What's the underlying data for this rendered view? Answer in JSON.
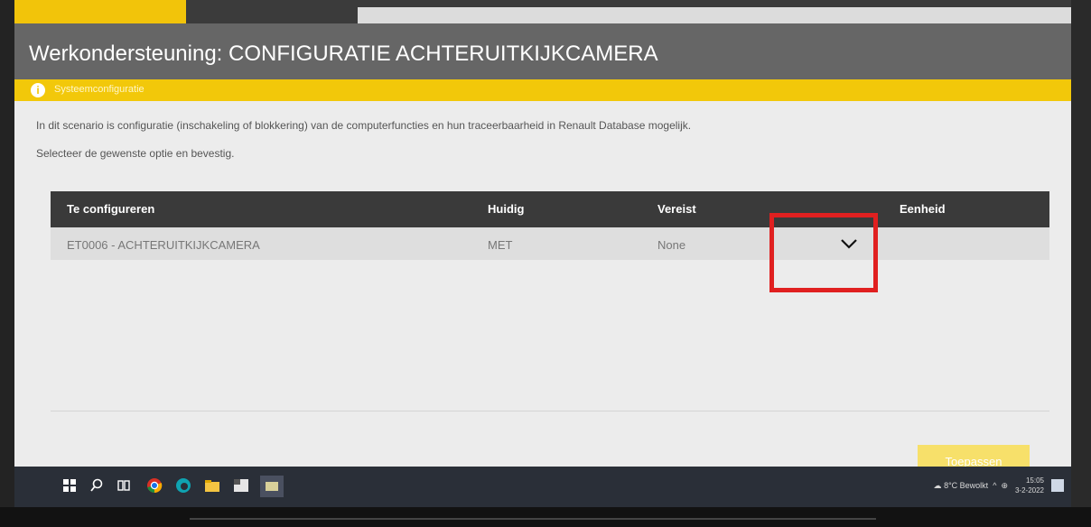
{
  "window": {
    "title": "Werkondersteuning: CONFIGURATIE ACHTERUITKIJKCAMERA"
  },
  "system_bar": {
    "label": "Systeemconfiguratie",
    "icon": "info-icon"
  },
  "description": "In dit scenario is configuratie (inschakeling of blokkering) van de computerfuncties en hun traceerbaarheid in Renault Database mogelijk.",
  "instruction": "Selecteer de gewenste optie en bevestig.",
  "table": {
    "headers": [
      "Te configureren",
      "Huidig",
      "Vereist",
      "Eenheid"
    ],
    "rows": [
      {
        "item": "ET0006 - ACHTERUITKIJKCAMERA",
        "current": "MET",
        "required": "None",
        "unit": ""
      }
    ]
  },
  "buttons": {
    "apply": "Toepassen"
  },
  "taskbar": {
    "tray_weather": "8°C Bewolkt",
    "clock_time": "15:05",
    "clock_date": "3-2-2022"
  },
  "colors": {
    "accent_yellow": "#f2c80a",
    "highlight_red": "#e02020",
    "header_dark": "#3a3a3a"
  }
}
